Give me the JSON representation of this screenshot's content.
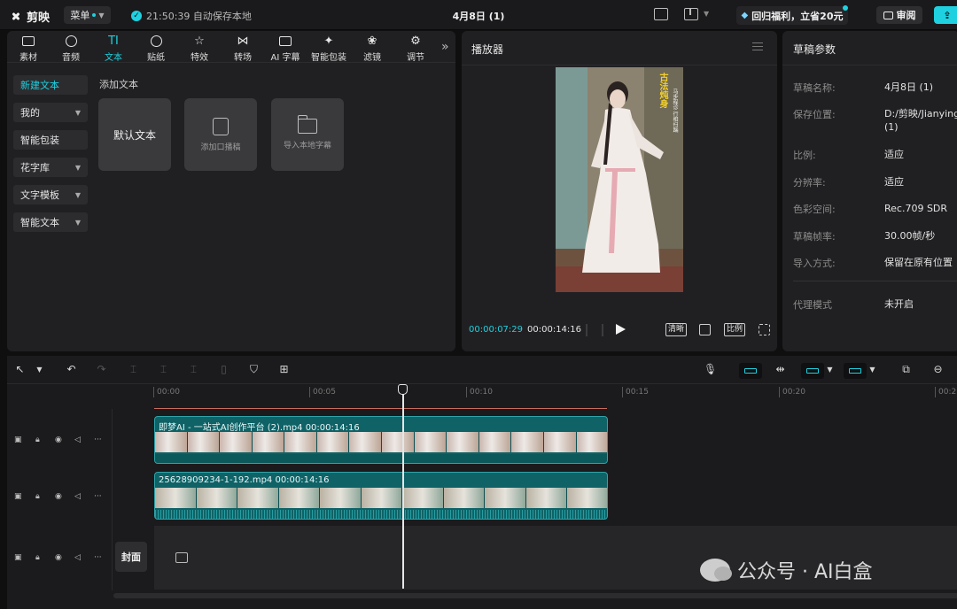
{
  "app": {
    "name": "剪映",
    "menu_label": "菜单",
    "autosave_text": "21:50:39 自动保存本地",
    "project_title": "4月8日 (1)",
    "promo_label": "回归福利，立省20元",
    "review_label": "审阅"
  },
  "categories": [
    {
      "label": "素材",
      "icon": "media-icon"
    },
    {
      "label": "音频",
      "icon": "audio-icon"
    },
    {
      "label": "文本",
      "icon": "text-icon",
      "active": true
    },
    {
      "label": "贴纸",
      "icon": "sticker-icon"
    },
    {
      "label": "特效",
      "icon": "effects-icon"
    },
    {
      "label": "转场",
      "icon": "transition-icon"
    },
    {
      "label": "AI 字幕",
      "icon": "ai-caption-icon"
    },
    {
      "label": "智能包装",
      "icon": "smart-pack-icon"
    },
    {
      "label": "滤镜",
      "icon": "filter-icon"
    },
    {
      "label": "调节",
      "icon": "adjust-icon"
    }
  ],
  "text_sidebar": [
    {
      "label": "新建文本",
      "active": true
    },
    {
      "label": "我的",
      "dropdown": true
    },
    {
      "label": "智能包装"
    },
    {
      "label": "花字库",
      "dropdown": true
    },
    {
      "label": "文字模板",
      "dropdown": true
    },
    {
      "label": "智能文本",
      "dropdown": true
    }
  ],
  "text_section": {
    "title": "添加文本",
    "cards": [
      "默认文本",
      "添加口播稿",
      "导入本地字幕"
    ]
  },
  "player": {
    "title": "播放器",
    "overlay_title": "古法炖身",
    "overlay_subtitle": "马步程诊 行相扫踹",
    "current_time": "00:00:07:29",
    "total_time": "00:00:14:16",
    "quality_label": "清晰",
    "ratio_label": "比例"
  },
  "params": {
    "title": "草稿参数",
    "rows": [
      {
        "key": "草稿名称:",
        "value": "4月8日 (1)"
      },
      {
        "key": "保存位置:",
        "value": "D:/剪映/Jianying (1)"
      },
      {
        "key": "比例:",
        "value": "适应"
      },
      {
        "key": "分辨率:",
        "value": "适应"
      },
      {
        "key": "色彩空间:",
        "value": "Rec.709 SDR"
      },
      {
        "key": "草稿帧率:",
        "value": "30.00帧/秒"
      },
      {
        "key": "导入方式:",
        "value": "保留在原有位置"
      },
      {
        "key": "代理模式",
        "value": "未开启"
      }
    ]
  },
  "timeline": {
    "ruler_ticks": [
      "00:00",
      "00:05",
      "00:10",
      "00:15",
      "00:20",
      "00:2"
    ],
    "clip1_label": "即梦AI - 一站式AI创作平台 (2).mp4   00:00:14:16",
    "clip2_label": "25628909234-1-192.mp4   00:00:14:16",
    "cover_label": "封面"
  },
  "watermark": "公众号 · AI白盒",
  "colors": {
    "accent": "#1fd1e0",
    "clip": "#0f6266",
    "background": "#0f0f10"
  }
}
